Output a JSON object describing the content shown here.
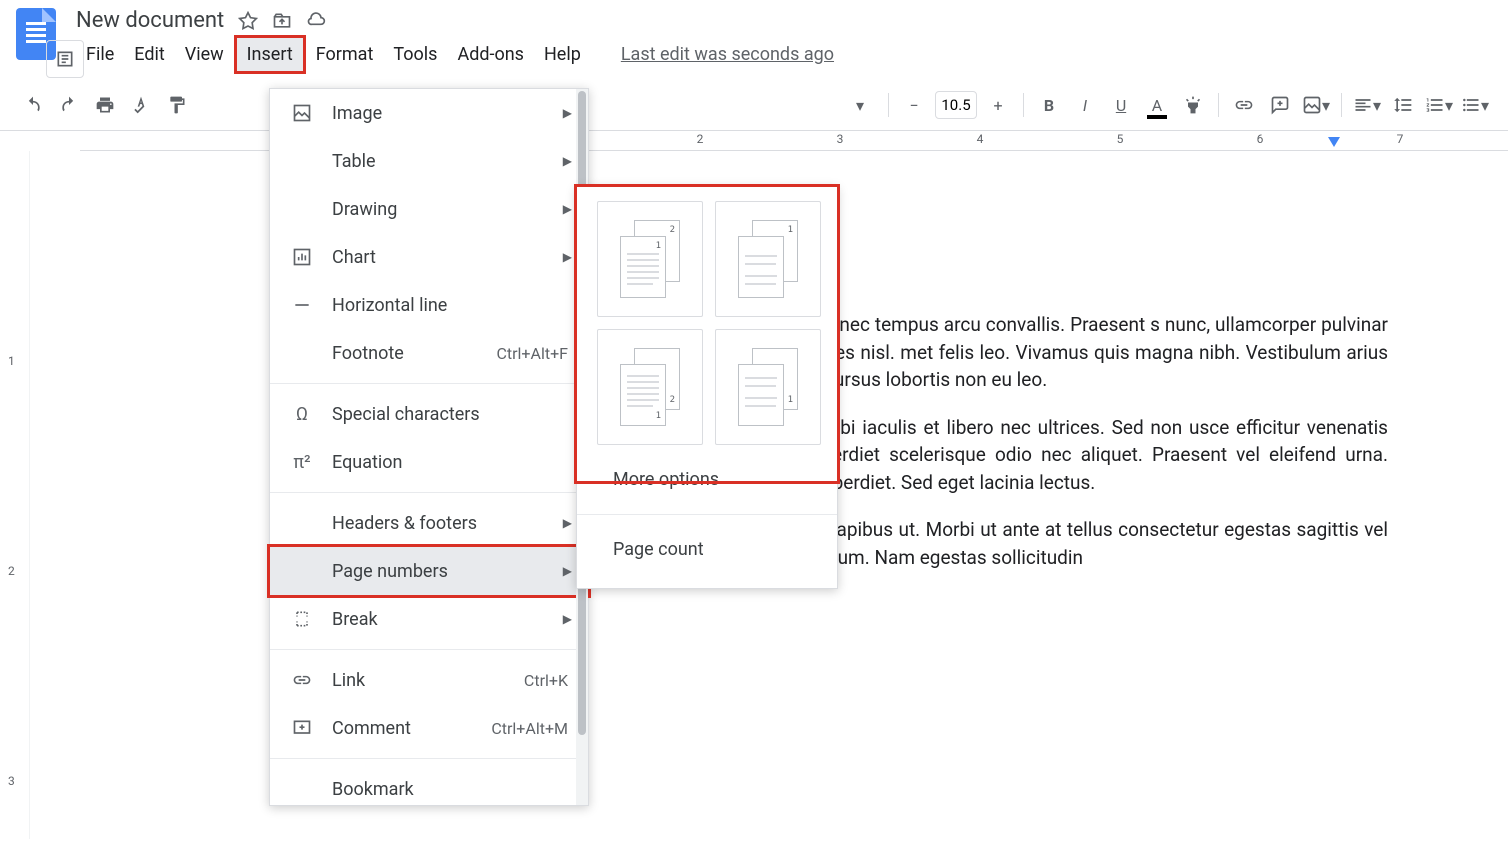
{
  "doc": {
    "title": "New document",
    "last_edit": "Last edit was seconds ago"
  },
  "menubar": {
    "file": "File",
    "edit": "Edit",
    "view": "View",
    "insert": "Insert",
    "format": "Format",
    "tools": "Tools",
    "addons": "Add-ons",
    "help": "Help"
  },
  "toolbar": {
    "font_size": "10.5"
  },
  "ruler": {
    "marks": [
      "2",
      "3",
      "4",
      "5",
      "6",
      "7"
    ]
  },
  "vruler": {
    "marks": [
      "1",
      "2",
      "3"
    ]
  },
  "insert_menu": {
    "image": "Image",
    "table": "Table",
    "drawing": "Drawing",
    "chart": "Chart",
    "horizontal_line": "Horizontal line",
    "footnote": "Footnote",
    "footnote_shortcut": "Ctrl+Alt+F",
    "special_characters": "Special characters",
    "equation": "Equation",
    "headers_footers": "Headers & footers",
    "page_numbers": "Page numbers",
    "break": "Break",
    "link": "Link",
    "link_shortcut": "Ctrl+K",
    "comment": "Comment",
    "comment_shortcut": "Ctrl+Alt+M",
    "bookmark": "Bookmark"
  },
  "submenu": {
    "more_options": "More options",
    "page_count": "Page count"
  },
  "body_text": {
    "p1": "iscing elit. Praesent rhoncus cursus magna blandit rci vestibulum, nec tempus arcu convallis. Praesent s nunc, ullamcorper pulvinar urna et, mollis euismod am ac nulla pharetra, finibus nisl id, sodales nisl. met felis leo. Vivamus quis magna nibh. Vestibulum arius varius tortor, at vehicula nulla vulputate vel. Sed olor eleifend est cursus lobortis non eu leo.",
    "p2": "i luctus et ultrices posuere cubilia curae; Vivamus ci aliquet. Morbi iaculis et libero nec ultrices. Sed non usce efficitur venenatis placerat. Vestibulum dapibus entum mi blandit in. Mauris imperdiet scelerisque odio nec aliquet. Praesent vel eleifend urna. Vivamus iaculis pharetra sem ut fermentum. Aliquam d dictum imperdiet. Sed eget lacinia lectus.",
    "p3": "m augue. Praesent malesuada vehicula dolor, sed luctus massa dapibus ut. Morbi ut ante at tellus consectetur egestas sagittis vel magna. Maecenas si in aliquam. Aliquam feugiat sed nibh non rutrum. Nam egestas sollicitudin"
  }
}
